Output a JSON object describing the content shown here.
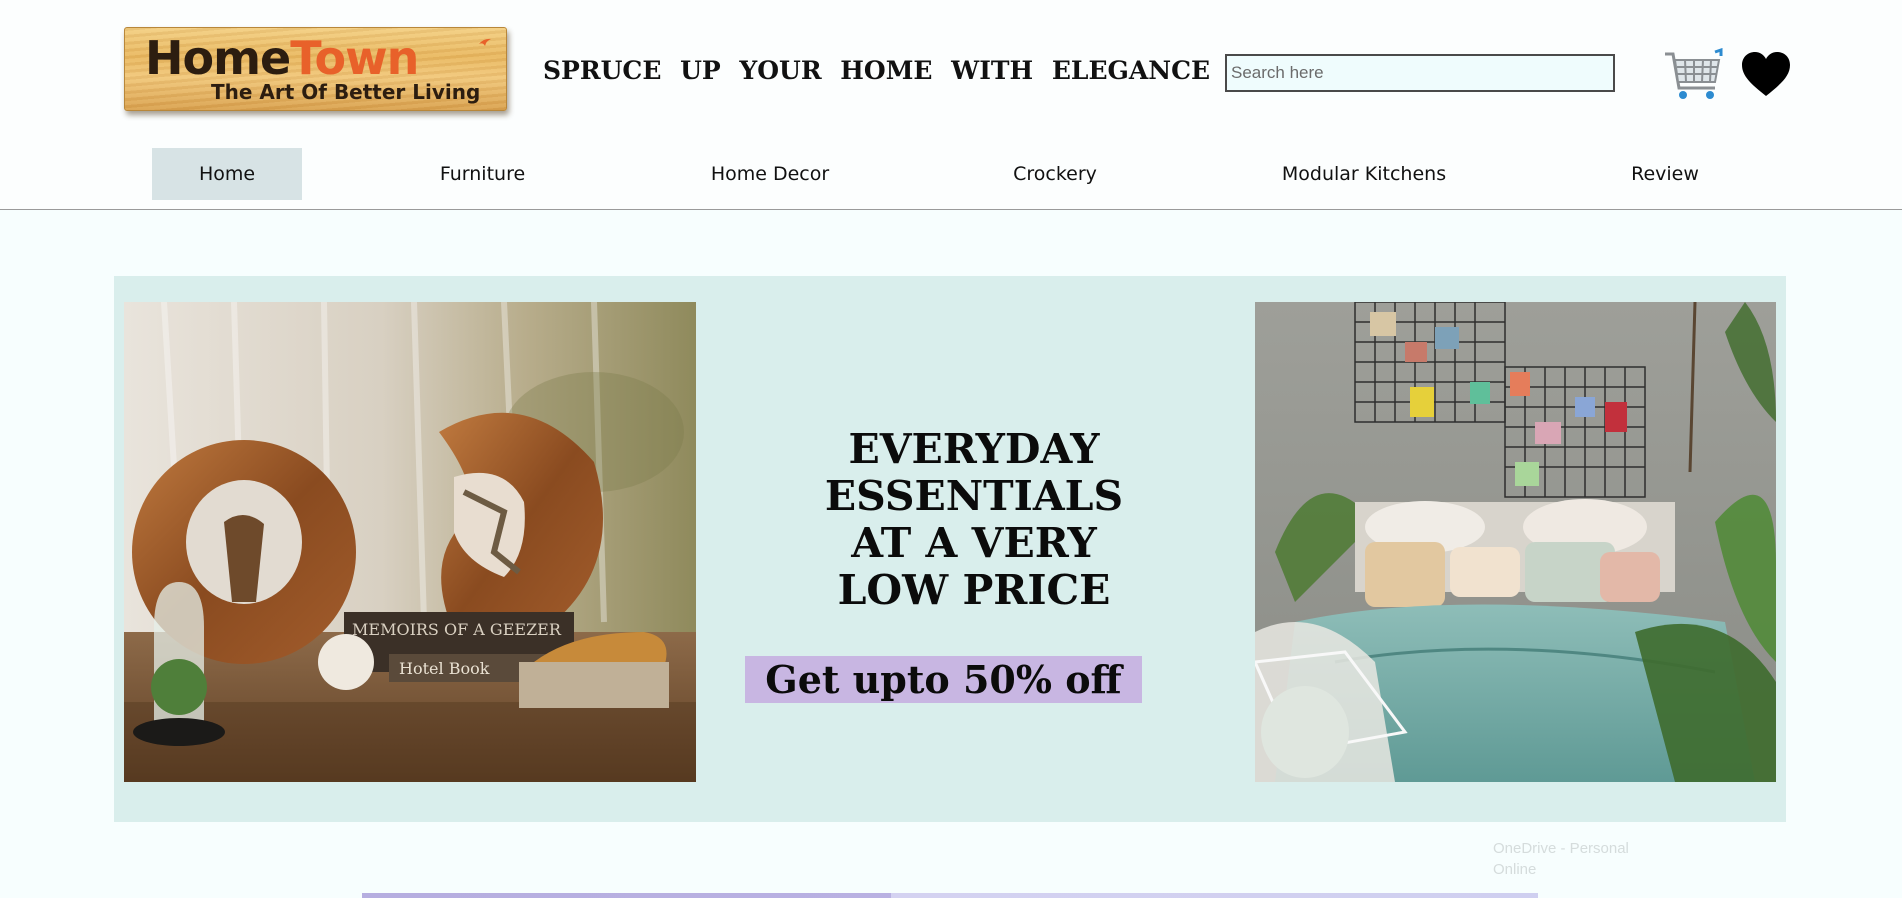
{
  "brand": {
    "name_part1": "Home",
    "name_part2": "Town",
    "slogan": "The Art Of Better Living"
  },
  "tagline": "SPRUCE UP YOUR HOME WITH ELEGANCE",
  "search": {
    "placeholder": "Search here",
    "value": ""
  },
  "icons": {
    "cart": "cart-icon",
    "wishlist": "heart-icon"
  },
  "nav": {
    "items": [
      {
        "label": "Home",
        "active": true
      },
      {
        "label": "Furniture"
      },
      {
        "label": "Home Decor"
      },
      {
        "label": "Crockery"
      },
      {
        "label": "Modular Kitchens"
      },
      {
        "label": "Review"
      }
    ]
  },
  "banner": {
    "headline_lines": [
      "EVERYDAY",
      "ESSENTIALS",
      "AT A VERY",
      "LOW PRICE"
    ],
    "offer": "Get upto 50% off",
    "left_image_book_text": [
      "MEMOIRS OF A GEEZER",
      "Hotel Book"
    ]
  },
  "toast": {
    "line1": "OneDrive - Personal",
    "line2": "Online"
  },
  "colors": {
    "page_bg": "#f7fefe",
    "banner_bg": "#d9eeec",
    "offer_bg": "#c8b6e2",
    "nav_active_bg": "#d7e3e5",
    "logo_accent": "#e8612a"
  }
}
